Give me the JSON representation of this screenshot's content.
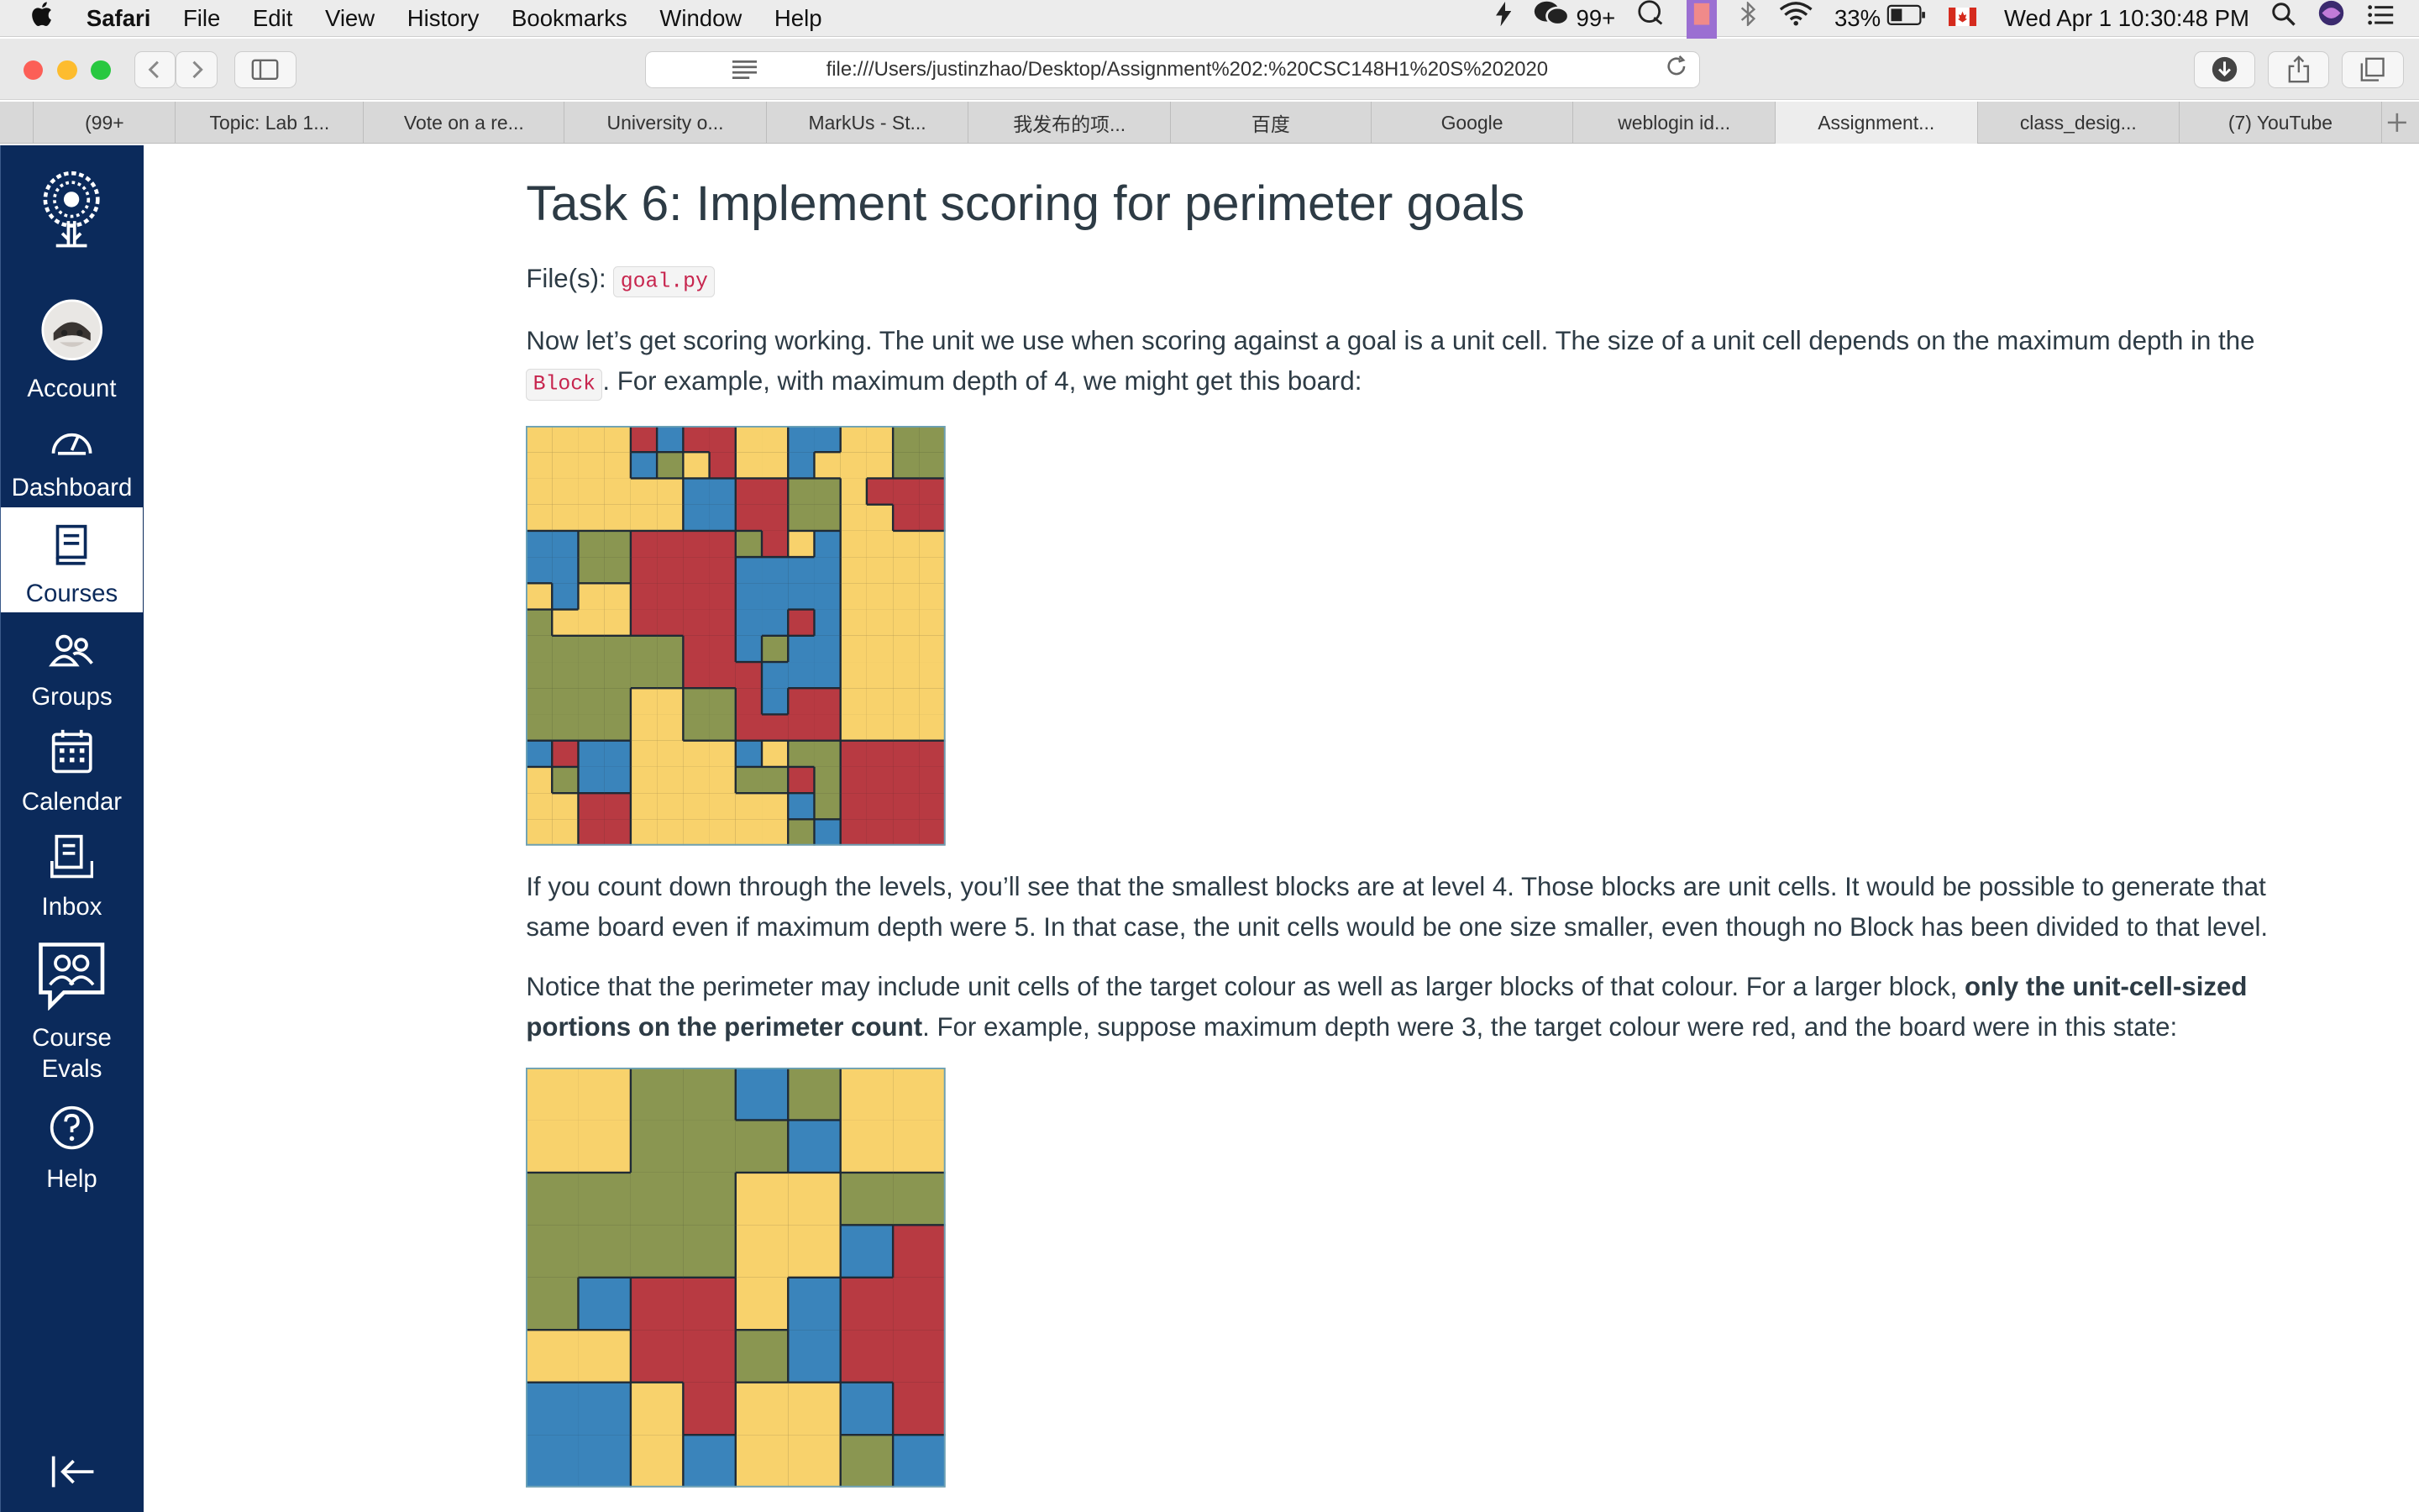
{
  "menubar": {
    "apple": "",
    "app_name": "Safari",
    "menus": [
      "File",
      "Edit",
      "View",
      "History",
      "Bookmarks",
      "Window",
      "Help"
    ],
    "notif_count": "99+",
    "battery": "33%",
    "datetime": "Wed Apr 1  10:30:48 PM"
  },
  "toolbar": {
    "url": "file:///Users/justinzhao/Desktop/Assignment%202:%20CSC148H1%20S%202020"
  },
  "tabs": [
    {
      "label": "(99+"
    },
    {
      "label": "Topic: Lab 1..."
    },
    {
      "label": "Vote on a re..."
    },
    {
      "label": "University o..."
    },
    {
      "label": "MarkUs - St..."
    },
    {
      "label": "我发布的项..."
    },
    {
      "label": "百度"
    },
    {
      "label": "Google"
    },
    {
      "label": "weblogin id..."
    },
    {
      "label": "Assignment..."
    },
    {
      "label": "class_desig..."
    },
    {
      "label": "(7) YouTube"
    }
  ],
  "nav": {
    "account": "Account",
    "dashboard": "Dashboard",
    "courses": "Courses",
    "groups": "Groups",
    "calendar": "Calendar",
    "inbox": "Inbox",
    "course_evals_1": "Course",
    "course_evals_2": "Evals",
    "help": "Help"
  },
  "content": {
    "title": "Task 6: Implement scoring for perimeter goals",
    "files_label": "File(s): ",
    "files_code": "goal.py",
    "p1_a": "Now let’s get scoring working. The unit we use when scoring against a goal is a unit cell. The size of a unit cell depends on the maximum depth in the ",
    "p1_code": "Block",
    "p1_b": ". For example, with maximum depth of 4, we might get this board:",
    "p2": "If you count down through the levels, you’ll see that the smallest blocks are at level 4. Those blocks are unit cells. It would be possible to generate that same board even if maximum depth were 5. In that case, the unit cells would be one size smaller, even though no Block has been divided to that level.",
    "p3_a": "Notice that the perimeter may include unit cells of the target colour as well as larger blocks of that colour. For a larger block, ",
    "p3_bold": "only the unit-cell-sized portions on the perimeter count",
    "p3_b": ". For example, suppose maximum depth were 3, the target colour were red, and the board were in this state:"
  },
  "colors": {
    "Y": "#f8d26c",
    "G": "#8a9651",
    "R": "#b83a42",
    "B": "#3a84bb"
  },
  "boards": {
    "board1": [
      "YYYYRBRRYYBBYYGG",
      "YYYYBGYRYYBYYYGG",
      "YYYYYYBBRRGGYRRR",
      "YYYYYYBBRRGGYYRR",
      "BBGGRRRRGRYBYYYY",
      "BBGGRRRRBBBBYYYY",
      "YBYYRRRRBBBBYYYY",
      "GYYYRRRRBBRBYYYY",
      "GGGGGGRRBGBBYYYY",
      "GGGGGGRRRBBBYYYY",
      "GGGGYYGGRBRRYYYY",
      "GGGGYYGGRRRRYYYY",
      "BRBBYYYYBYGGRRRR",
      "YGBBYYYYGGRGRRRR",
      "YYRRYYYYYYBGRRRR",
      "YYRRYYYYYYGBRRRR"
    ],
    "board2": [
      "YYGGBGYY",
      "YYGGGBYY",
      "GGGGYYGG",
      "GGGGYYBR",
      "GBRRYBRR",
      "YYRRGBRR",
      "BBYRYYBR",
      "BBYBYYGB"
    ]
  }
}
